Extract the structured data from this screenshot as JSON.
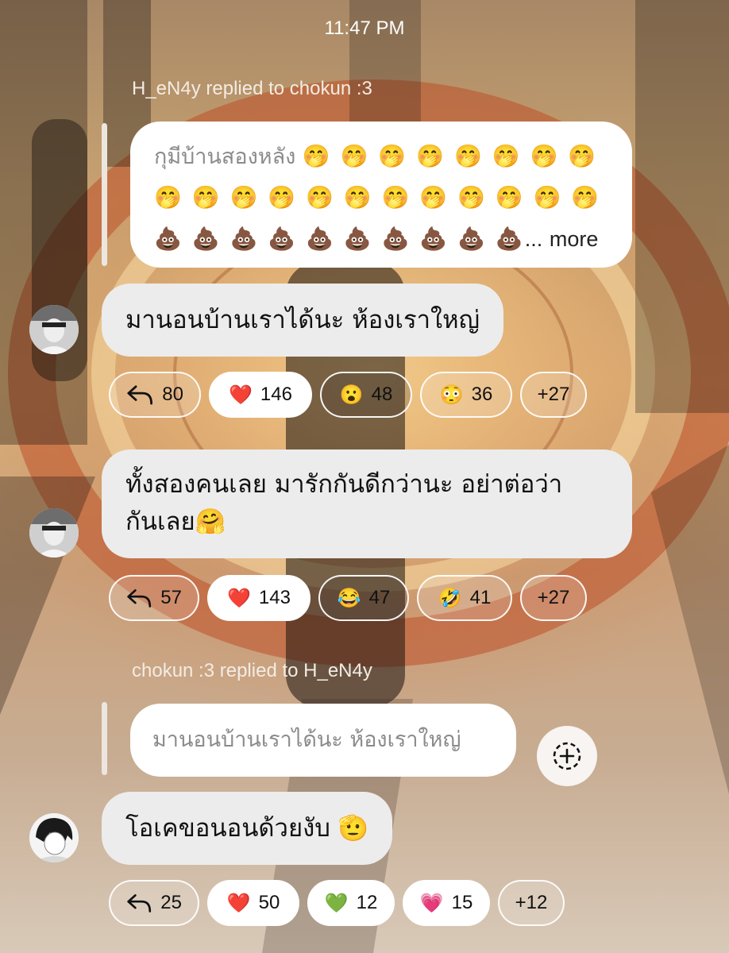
{
  "status": {
    "time": "11:47 PM"
  },
  "threads": [
    {
      "header": "H_eN4y replied to chokun :3",
      "quote": {
        "text": "กุมีบ้านสองหลัง",
        "line1_emoji": "🤭 🤭 🤭 🤭 🤭 🤭 🤭 🤭",
        "line2_emoji": "🤭 🤭 🤭 🤭 🤭 🤭 🤭 🤭 🤭 🤭 🤭 🤭",
        "line3_emoji": "💩 💩 💩 💩 💩 💩 💩 💩 💩 💩",
        "ellipsis": "...",
        "more": "more"
      },
      "message": "มานอนบ้านเราได้นะ ห้องเราใหญ่",
      "reactions": [
        {
          "icon": "reply-icon",
          "glyph": "",
          "count": "80",
          "style": "glass"
        },
        {
          "icon": "heart-emoji",
          "glyph": "❤️",
          "count": "146",
          "style": "solid"
        },
        {
          "icon": "surprised-emoji",
          "glyph": "😮",
          "count": "48",
          "style": "glass-dark"
        },
        {
          "icon": "flushed-emoji",
          "glyph": "😳",
          "count": "36",
          "style": "glass"
        },
        {
          "icon": "",
          "glyph": "",
          "count": "+27",
          "style": "glass"
        }
      ]
    },
    {
      "message_line1": "ทั้งสองคนเลย มารักกันดีกว่านะ อย่าต่อว่า",
      "message_line2": "กันเลย",
      "message_emoji": "🤗",
      "reactions": [
        {
          "icon": "reply-icon",
          "glyph": "",
          "count": "57",
          "style": "glass"
        },
        {
          "icon": "heart-emoji",
          "glyph": "❤️",
          "count": "143",
          "style": "solid"
        },
        {
          "icon": "tears-of-joy-emoji",
          "glyph": "😂",
          "count": "47",
          "style": "glass-dark"
        },
        {
          "icon": "rofl-emoji",
          "glyph": "🤣",
          "count": "41",
          "style": "glass"
        },
        {
          "icon": "",
          "glyph": "",
          "count": "+27",
          "style": "glass"
        }
      ]
    },
    {
      "header": "chokun :3 replied to H_eN4y",
      "quote": {
        "text": "มานอนบ้านเราได้นะ ห้องเราใหญ่"
      },
      "message": "โอเคขอนอนด้วยงับ",
      "message_emoji": "🫡",
      "reactions": [
        {
          "icon": "reply-icon",
          "glyph": "",
          "count": "25",
          "style": "glass"
        },
        {
          "icon": "heart-emoji",
          "glyph": "❤️",
          "count": "50",
          "style": "solid"
        },
        {
          "icon": "green-heart-emoji",
          "glyph": "💚",
          "count": "12",
          "style": "solid"
        },
        {
          "icon": "pink-heart-emoji",
          "glyph": "💗",
          "count": "15",
          "style": "solid"
        },
        {
          "icon": "",
          "glyph": "",
          "count": "+12",
          "style": "glass"
        }
      ]
    }
  ]
}
